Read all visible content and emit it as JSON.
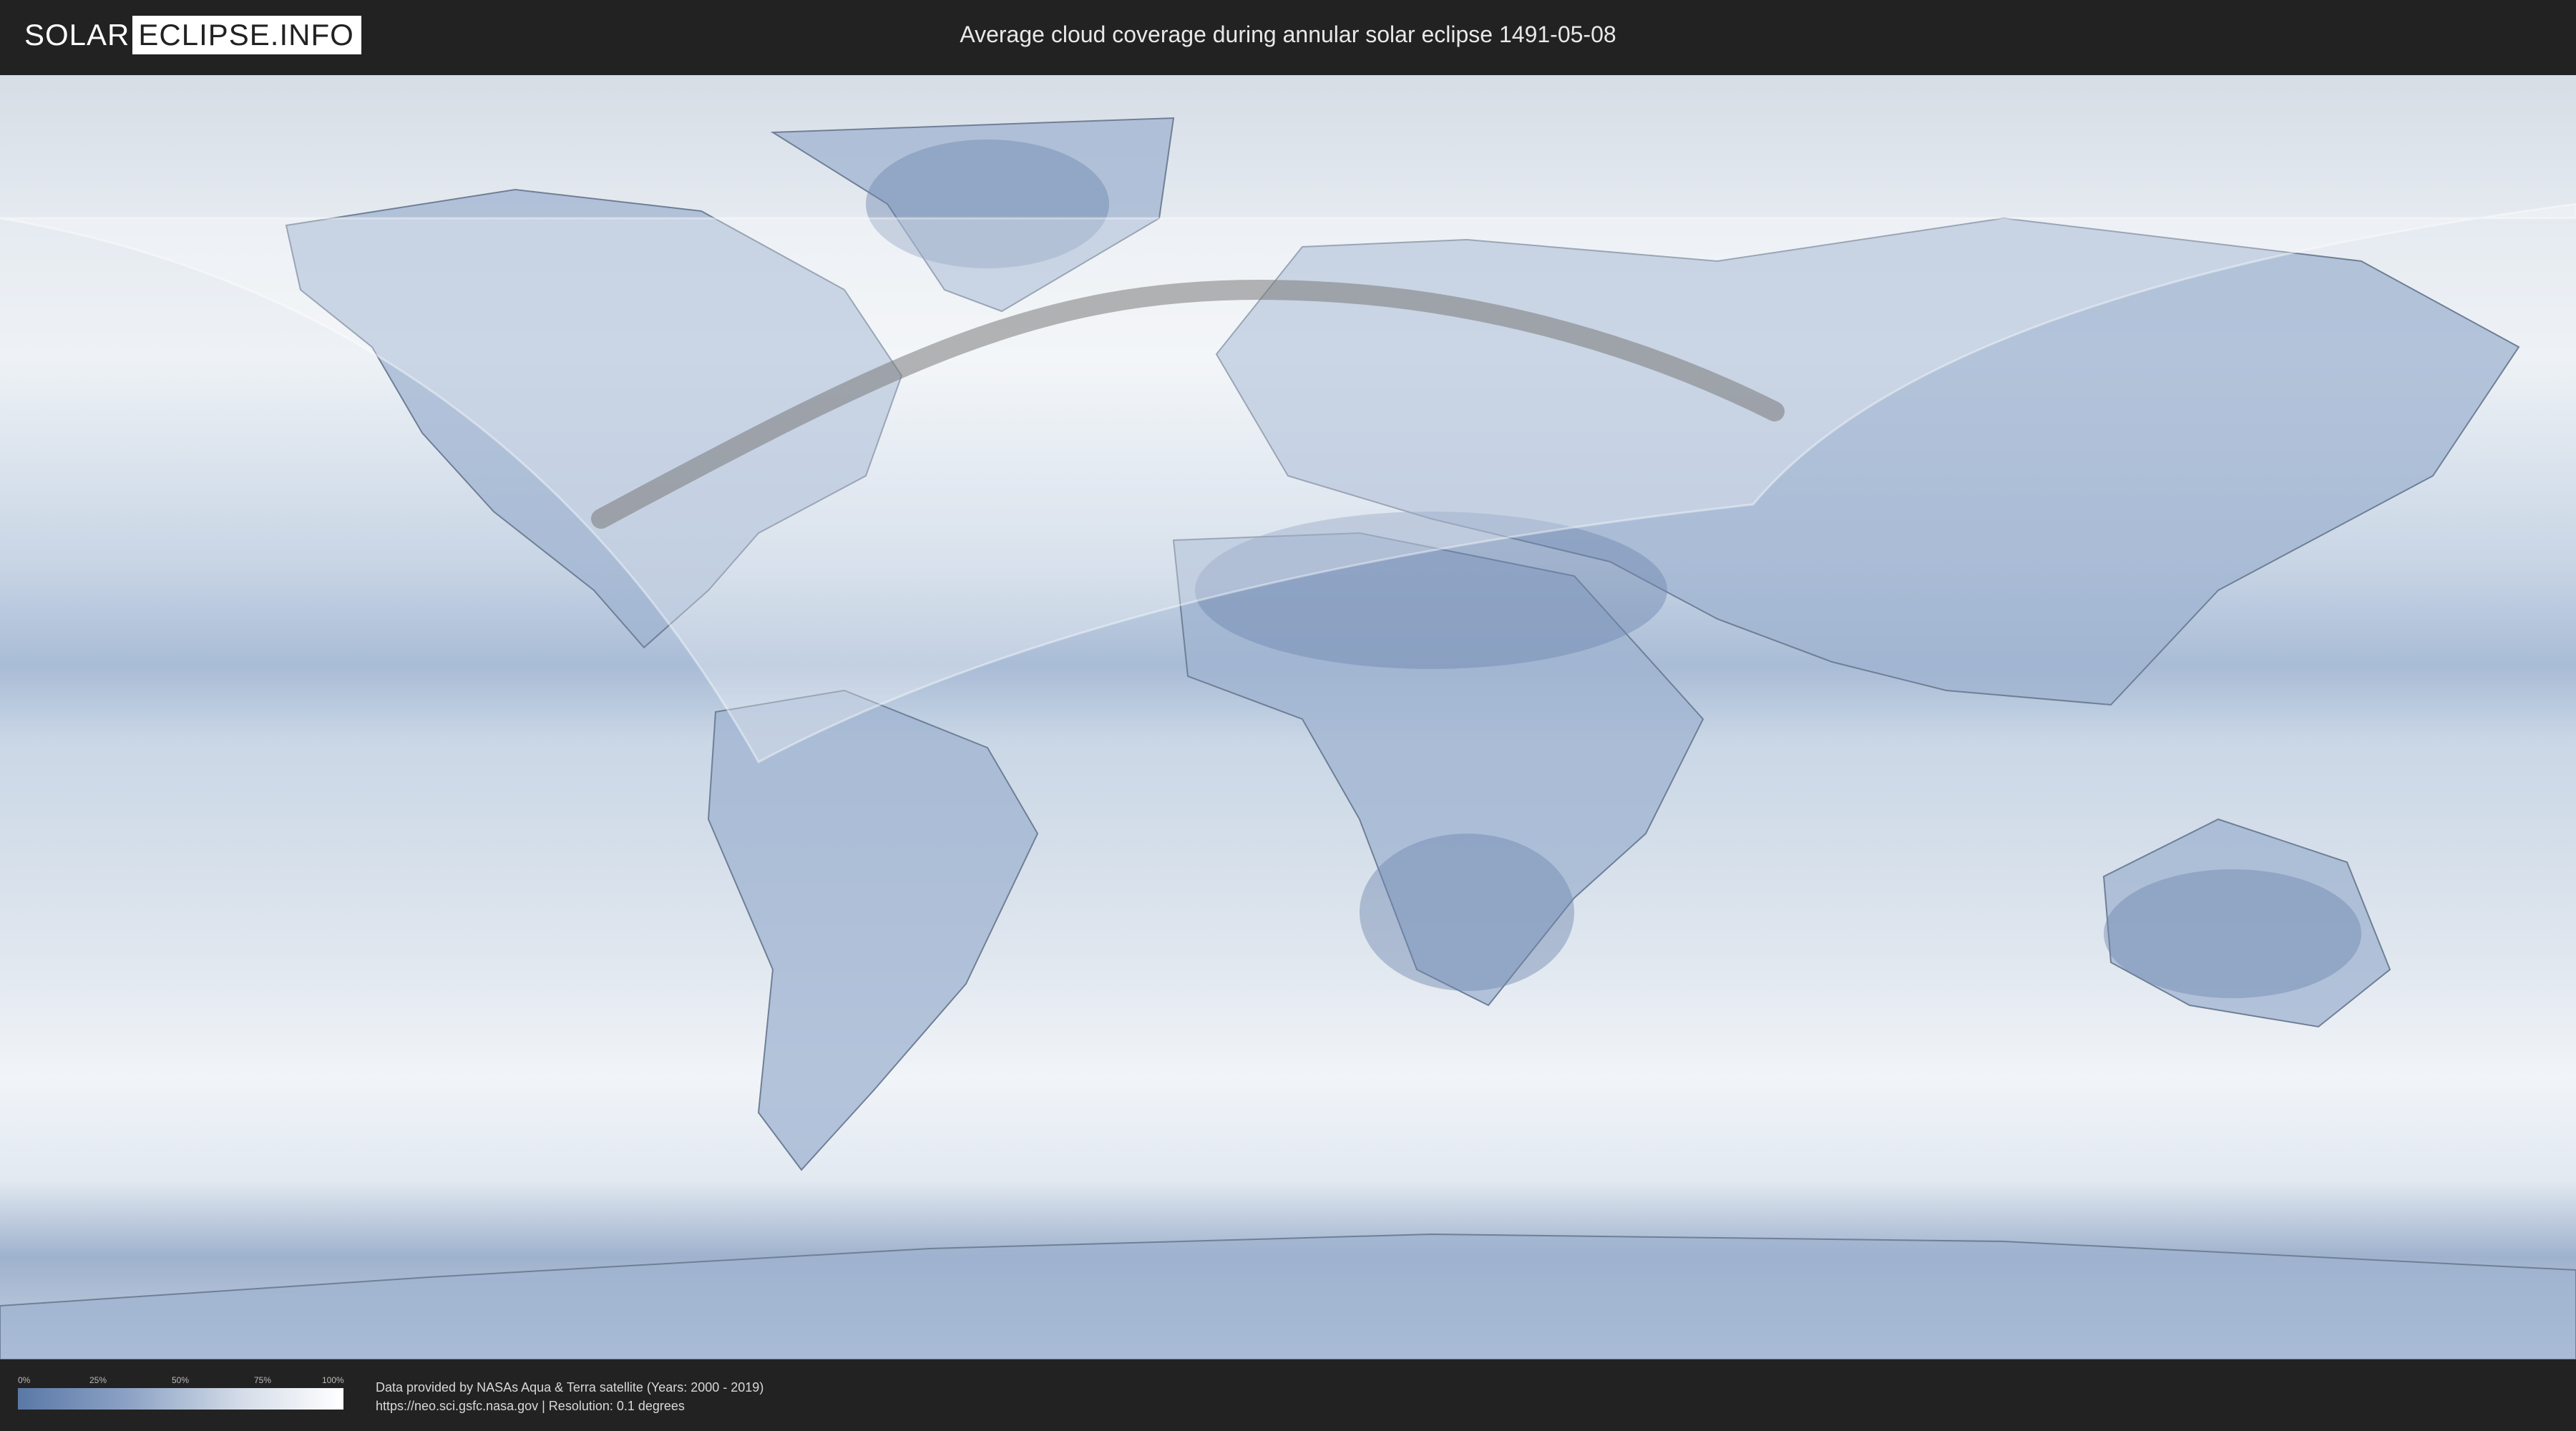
{
  "header": {
    "logo_part1": "SOLAR",
    "logo_part2": "ECLIPSE.INFO",
    "title": "Average cloud coverage during annular solar eclipse 1491-05-08"
  },
  "legend": {
    "ticks": [
      "0%",
      "25%",
      "50%",
      "75%",
      "100%"
    ]
  },
  "footer": {
    "credit_line1": "Data provided by NASAs Aqua & Terra satellite (Years: 2000 - 2019)",
    "credit_line2": "https://neo.sci.gsfc.nasa.gov | Resolution: 0.1 degrees"
  },
  "colors": {
    "background": "#222222",
    "map_ocean": "#cfd9e6",
    "clear_sky": "#5a78a6",
    "overcast": "#ffffff",
    "eclipse_path": "#7a7a7a",
    "visibility_zone": "#ffffff"
  }
}
